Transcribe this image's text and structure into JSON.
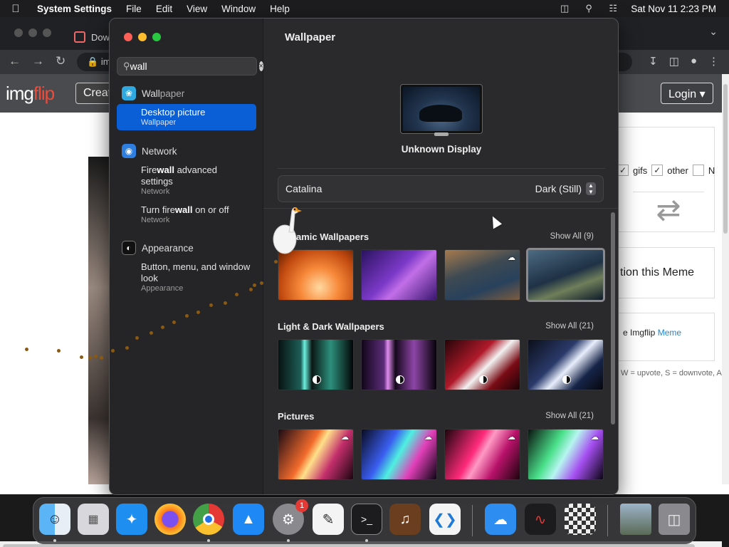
{
  "menubar": {
    "app_name": "System Settings",
    "items": [
      "File",
      "Edit",
      "View",
      "Window",
      "Help"
    ],
    "clock": "Sat Nov 11  2:23 PM"
  },
  "browser": {
    "tab_title": "Dow",
    "address_text": "im",
    "logo_img": "img",
    "logo_flip": "flip",
    "create_label": "Creat",
    "login_label": "Login ▾",
    "filter_gifs": "gifs",
    "filter_other": "other",
    "filter_n": "N",
    "caption_text": "tion this Meme",
    "imgflip_text": "e Imgflip",
    "meme_link": "Meme",
    "shortcut_hint": "W = upvote, S = downvote, A"
  },
  "sidebar": {
    "search_value": "wall",
    "groups": [
      {
        "title_pre": "",
        "title_match": "Wall",
        "title_post": "paper",
        "results": [
          {
            "pre": "Desktop picture",
            "match": "",
            "post": "",
            "sub": "Wallpaper"
          }
        ]
      },
      {
        "title_pre": "Network",
        "title_match": "",
        "title_post": "",
        "results": [
          {
            "pre": "Fire",
            "match": "wall",
            "post": " advanced settings",
            "sub": "Network"
          },
          {
            "pre": "Turn fire",
            "match": "wall",
            "post": " on or off",
            "sub": "Network"
          }
        ]
      },
      {
        "title_pre": "Appearance",
        "title_match": "",
        "title_post": "",
        "results": [
          {
            "pre": "Button, menu, and window look",
            "match": "",
            "post": "",
            "sub": "Appearance"
          }
        ]
      }
    ]
  },
  "content": {
    "title": "Wallpaper",
    "display_name": "Unknown Display",
    "picker_wallpaper": "Catalina",
    "picker_mode": "Dark (Still)",
    "sections": [
      {
        "name": "Dynamic Wallpapers",
        "name_visible": "amic Wallpapers",
        "show_all": "Show All (9)"
      },
      {
        "name": "Light & Dark Wallpapers",
        "name_visible": "Light & Dark Wallpapers",
        "show_all": "Show All (21)"
      },
      {
        "name": "Pictures",
        "name_visible": "Pictures",
        "show_all": "Show All (21)"
      }
    ]
  },
  "dock": {
    "settings_badge": "1",
    "apps": [
      "finder-icon",
      "launchpad-icon",
      "safari-icon",
      "firefox-icon",
      "chrome-icon",
      "app-store-icon",
      "system-settings-icon",
      "textedit-icon",
      "terminal-icon",
      "garageband-icon",
      "vscode-icon",
      "weather-icon",
      "voice-memos-icon",
      "chess-icon",
      "photo-icon",
      "trash-icon"
    ]
  }
}
